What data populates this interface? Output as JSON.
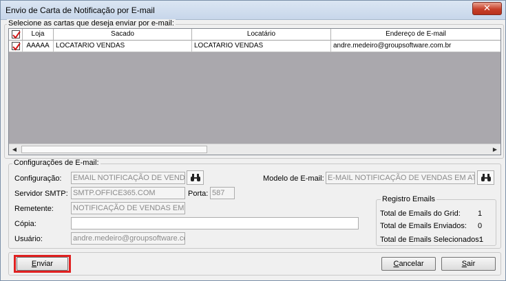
{
  "window": {
    "title": "Envio de Carta de Notificação por E-mail",
    "close_label": "✕"
  },
  "selection_group": {
    "legend": "Selecione as cartas que deseja enviar por e-mail:"
  },
  "grid": {
    "columns": [
      "",
      "Loja",
      "Sacado",
      "Locatário",
      "Endereço de E-mail"
    ],
    "rows": [
      {
        "checked": true,
        "loja": "AAAAA",
        "sacado": "LOCATARIO VENDAS",
        "locatario": "LOCATARIO VENDAS",
        "email": "andre.medeiro@groupsoftware.com.br"
      }
    ],
    "scroll_left": "◀",
    "scroll_right": "▶"
  },
  "config_group": {
    "legend": "Configurações de E-mail:",
    "configuracao_label": "Configuração:",
    "configuracao_value": "EMAIL NOTIFICAÇÃO DE VENDA",
    "modelo_label": "Modelo de E-mail:",
    "modelo_value": "E-MAIL NOTIFICAÇÃO DE VENDAS EM ATRA",
    "smtp_label": "Servidor SMTP:",
    "smtp_value": "SMTP.OFFICE365.COM",
    "porta_label": "Porta:",
    "porta_value": "587",
    "remetente_label": "Remetente:",
    "remetente_value": "NOTIFICAÇÃO DE VENDAS EM ATR",
    "copia_label": "Cópia:",
    "copia_value": "",
    "usuario_label": "Usuário:",
    "usuario_value": "andre.medeiro@groupsoftware.cc"
  },
  "registro": {
    "legend": "Registro Emails",
    "total_grid_label": "Total de Emails do Grid:",
    "total_grid_value": "1",
    "total_enviados_label": "Total de Emails Enviados:",
    "total_enviados_value": "0",
    "total_selecionados_label": "Total de Emails Selecionados:",
    "total_selecionados_value": "1"
  },
  "buttons": {
    "enviar": {
      "first": "E",
      "rest": "nviar"
    },
    "cancelar": {
      "first": "C",
      "rest": "ancelar"
    },
    "sair": {
      "first": "S",
      "rest": "air"
    }
  },
  "colors": {
    "highlight": "#e02020",
    "check": "#d01818"
  }
}
